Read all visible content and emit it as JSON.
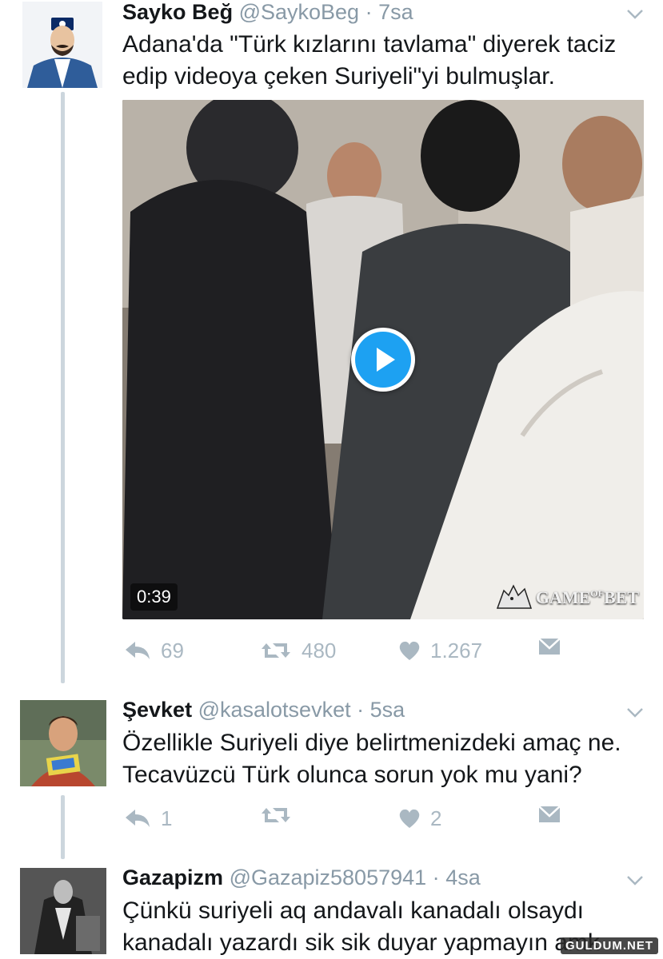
{
  "tweets": [
    {
      "name": "Sayko Beğ",
      "handle": "@SaykoBeg",
      "separator": "·",
      "time": "7sa",
      "text_lines": [
        "Adana'da \"Türk kızlarını tavlama\" diyerek taciz",
        "edip videoya çeken Suriyeli\"yi bulmuşlar."
      ],
      "avatar_icon": "profile-portrait",
      "video": {
        "duration": "0:39",
        "watermark": "GAME OF BET",
        "watermark_text": "GAME",
        "watermark_sup": "OF",
        "watermark_end": "BET"
      },
      "stats": {
        "replies": "69",
        "retweets": "480",
        "likes": "1.267"
      }
    },
    {
      "name": "Şevket",
      "handle": "@kasalotsevket",
      "separator": "·",
      "time": "5sa",
      "text_lines": [
        "Özellikle Suriyeli diye belirtmenizdeki amaç ne.",
        "Tecavüzcü Türk olunca sorun yok mu yani?"
      ],
      "avatar_icon": "profile-portrait",
      "stats": {
        "replies": "1",
        "retweets": "",
        "likes": "2"
      }
    },
    {
      "name": "Gazapizm",
      "handle": "@Gazapiz58057941",
      "separator": "·",
      "time": "4sa",
      "text_lines": [
        "Çünkü suriyeli aq andavalı kanadalı olsaydı",
        "kanadalı yazardı sik sik duyar yapmayın amk"
      ],
      "avatar_icon": "profile-portrait"
    }
  ],
  "site_logo": "GULDUM.NET",
  "colors": {
    "text": "#14171a",
    "muted": "#8899a6",
    "icon": "#aab8c2",
    "accent": "#1da1f2",
    "thread_line": "#ccd6dd"
  }
}
